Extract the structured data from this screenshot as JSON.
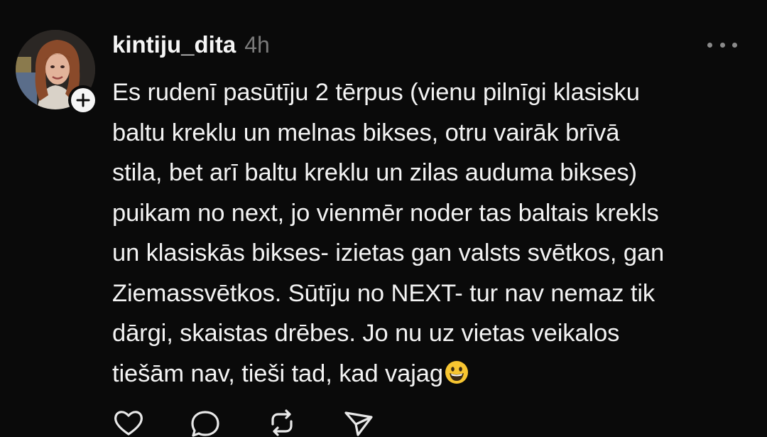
{
  "post": {
    "username": "kintiju_dita",
    "time": "4h",
    "lines": [
      "Es rudenī pasūtīju 2 tērpus (vienu pilnīgi klasisku",
      "baltu kreklu un melnas bikses, otru vairāk brīvā",
      "stila, bet arī baltu kreklu un zilas auduma bikses)",
      "puikam no next, jo vienmēr noder tas baltais krekls",
      "un klasiskās bikses- izietas gan valsts svētkos, gan",
      "Ziemassvētkos. Sūtīju no NEXT- tur nav nemaz tik",
      "dārgi, skaistas drēbes.  Jo nu uz vietas veikalos",
      "tiešām nav, tieši tad, kad vajag"
    ],
    "trailing_emoji": "grinning-face-emoji"
  },
  "icons": {
    "avatar": "avatar-photo",
    "follow": "plus-icon",
    "more": "more-dots-icon",
    "like": "heart-icon",
    "reply": "comment-icon",
    "repost": "repost-icon",
    "share": "send-icon"
  },
  "colors": {
    "background": "#0a0a0a",
    "text": "#f3f3f3",
    "muted": "#7a7a7a",
    "emoji": "#f7c531"
  }
}
